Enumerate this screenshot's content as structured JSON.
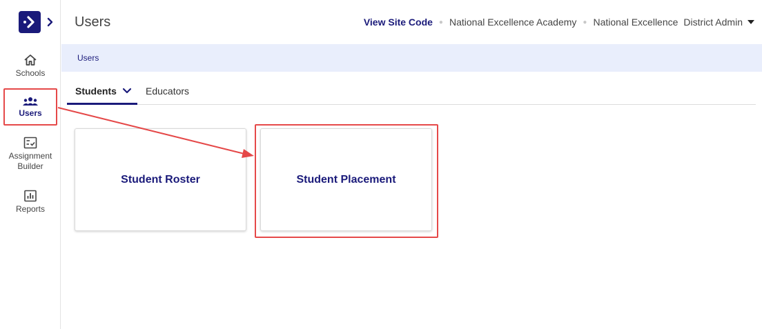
{
  "sidebar": {
    "logo_icon": "arrow-right-logo-icon",
    "expand_icon": "chevron-right-icon",
    "items": [
      {
        "label": "Schools",
        "icon": "home-icon",
        "active": false
      },
      {
        "label": "Users",
        "icon": "users-icon",
        "active": true
      },
      {
        "label": "Assignment Builder",
        "label_line1": "Assignment",
        "label_line2": "Builder",
        "icon": "checklist-icon",
        "active": false
      },
      {
        "label": "Reports",
        "icon": "bar-chart-icon",
        "active": false
      }
    ]
  },
  "header": {
    "title": "Users",
    "site_code_label": "View Site Code",
    "school": "National Excellence Academy",
    "district": "National Excellence",
    "user_role": "District Admin"
  },
  "breadcrumb": {
    "items": [
      "Users"
    ]
  },
  "tabs": [
    {
      "label": "Students",
      "active": true,
      "has_dropdown": true
    },
    {
      "label": "Educators",
      "active": false
    }
  ],
  "cards": [
    {
      "label": "Student Roster"
    },
    {
      "label": "Student Placement",
      "highlighted": true
    }
  ],
  "colors": {
    "brand": "#1a1a7a",
    "breadcrumb_bg": "#e9eefc",
    "annotation": "#e54848"
  }
}
